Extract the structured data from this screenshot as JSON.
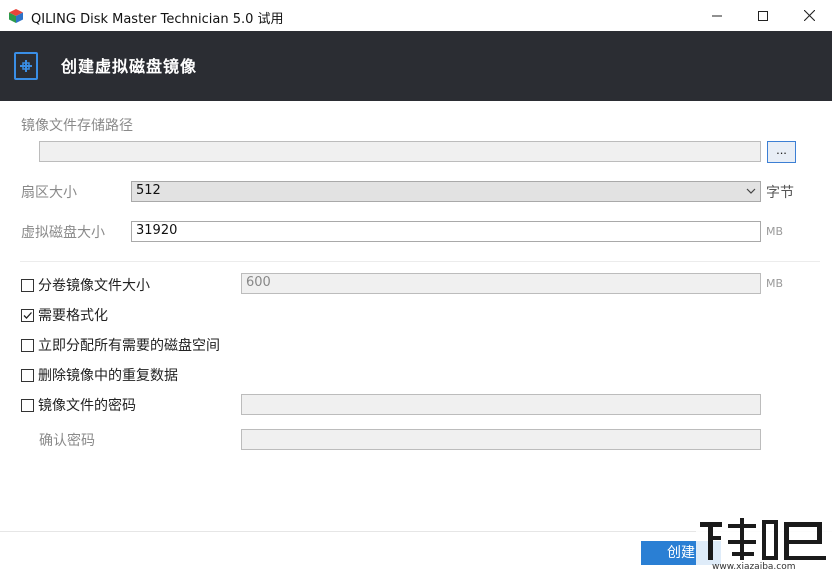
{
  "window": {
    "title": "QILING Disk Master Technician 5.0 试用",
    "minimize_label": "—",
    "maximize_label": "☐",
    "close_label": "✕"
  },
  "header": {
    "title": "创建虚拟磁盘镜像"
  },
  "form": {
    "image_path_label": "镜像文件存储路径",
    "image_path_value": "",
    "browse_label": "...",
    "sector_size_label": "扇区大小",
    "sector_size_value": "512",
    "sector_size_unit": "字节",
    "disk_size_label": "虚拟磁盘大小",
    "disk_size_value": "31920",
    "disk_size_unit": "MB",
    "split_label": "分卷镜像文件大小",
    "split_value": "600",
    "split_unit": "MB",
    "split_checked": false,
    "format_label": "需要格式化",
    "format_checked": true,
    "preallocate_label": "立即分配所有需要的磁盘空间",
    "preallocate_checked": false,
    "dedup_label": "删除镜像中的重复数据",
    "dedup_checked": false,
    "password_label": "镜像文件的密码",
    "password_checked": false,
    "confirm_password_label": "确认密码"
  },
  "footer": {
    "create_label": "创建"
  },
  "watermark": {
    "text": "www.xiazaiba.com"
  },
  "colors": {
    "header_bg": "#2b2d33",
    "accent": "#2a7fd4"
  }
}
